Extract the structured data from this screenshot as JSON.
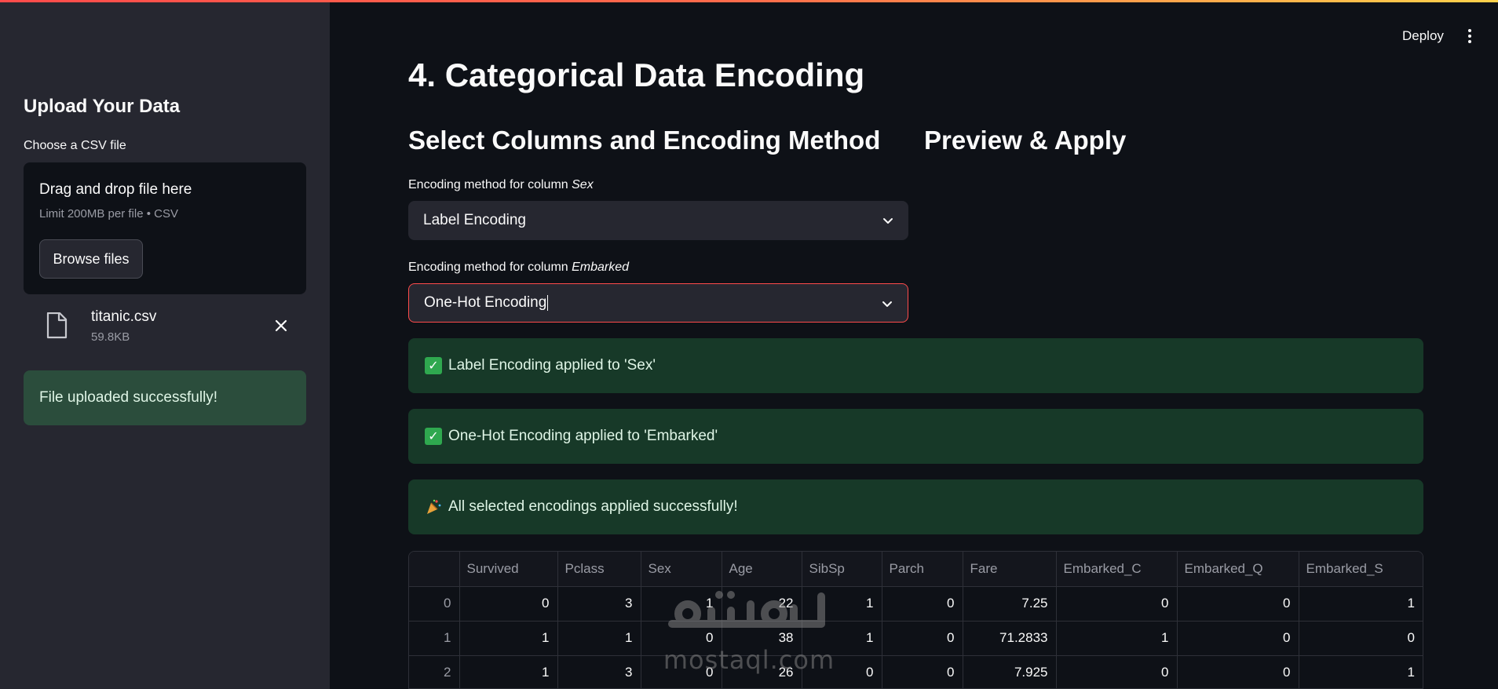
{
  "header": {
    "deploy_label": "Deploy"
  },
  "sidebar": {
    "title": "Upload Your Data",
    "uploader_label": "Choose a CSV file",
    "dropzone_title": "Drag and drop file here",
    "dropzone_limit": "Limit 200MB per file • CSV",
    "browse_label": "Browse files",
    "file": {
      "name": "titanic.csv",
      "size": "59.8KB"
    },
    "success_message": "File uploaded successfully!"
  },
  "main": {
    "title": "4. Categorical Data Encoding",
    "left_heading": "Select Columns and Encoding Method",
    "right_heading": "Preview & Apply",
    "fields": [
      {
        "label_prefix": "Encoding method for column ",
        "column": "Sex",
        "value": "Label Encoding"
      },
      {
        "label_prefix": "Encoding method for column ",
        "column": "Embarked",
        "value": "One-Hot Encoding"
      }
    ],
    "alerts": [
      {
        "icon": "check-icon",
        "text": "Label Encoding applied to 'Sex'"
      },
      {
        "icon": "check-icon",
        "text": "One-Hot Encoding applied to 'Embarked'"
      },
      {
        "icon": "party-popper-icon",
        "text": "All selected encodings applied successfully!"
      }
    ],
    "table": {
      "columns": [
        "",
        "Survived",
        "Pclass",
        "Sex",
        "Age",
        "SibSp",
        "Parch",
        "Fare",
        "Embarked_C",
        "Embarked_Q",
        "Embarked_S"
      ],
      "rows": [
        [
          "0",
          "0",
          "3",
          "1",
          "22",
          "1",
          "0",
          "7.25",
          "0",
          "0",
          "1"
        ],
        [
          "1",
          "1",
          "1",
          "0",
          "38",
          "1",
          "0",
          "71.2833",
          "1",
          "0",
          "0"
        ],
        [
          "2",
          "1",
          "3",
          "0",
          "26",
          "0",
          "0",
          "7.925",
          "0",
          "0",
          "1"
        ]
      ]
    }
  },
  "watermark": {
    "arabic": "مستقل",
    "latin": "mostaql.com"
  },
  "colors": {
    "accent": "#ff4b4b",
    "success_bg": "#173928",
    "sidebar_bg": "#262730",
    "app_bg": "#0e1117"
  }
}
